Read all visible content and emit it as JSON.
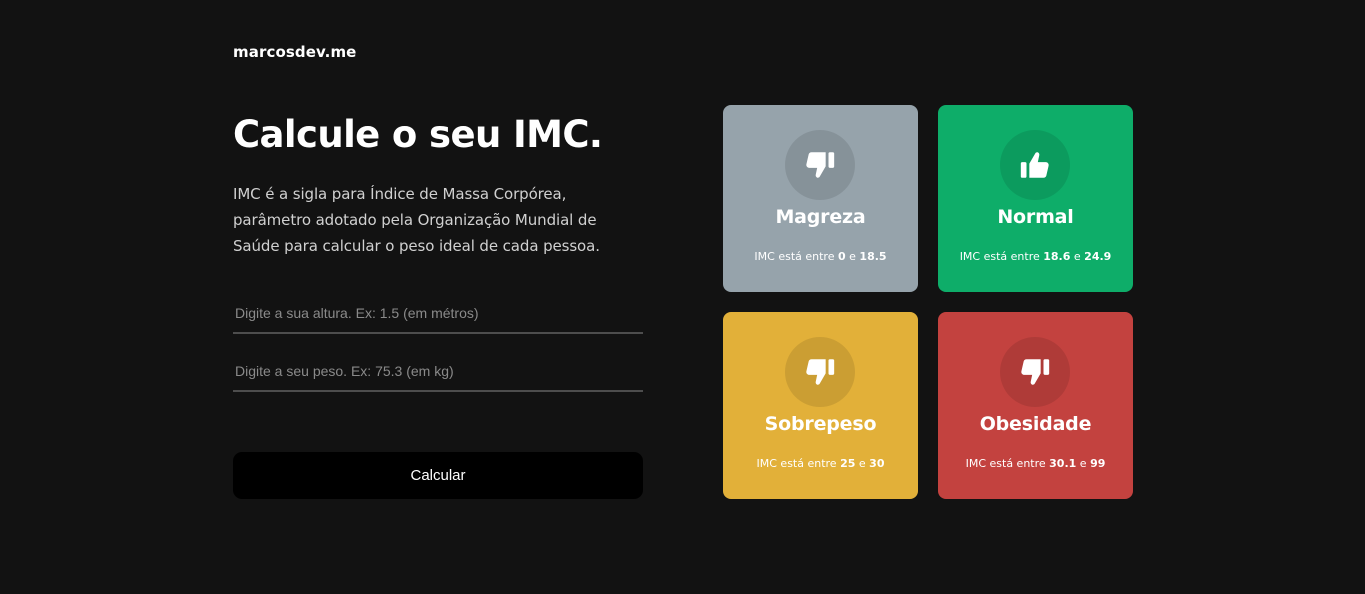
{
  "brand": "marcosdev.me",
  "hero": {
    "title": "Calcule o seu IMC.",
    "description_lines": [
      "IMC é a sigla para Índice de Massa Corpórea,",
      "parâmetro adotado pela Organização Mundial de",
      "Saúde para calcular o peso ideal de cada pessoa."
    ]
  },
  "form": {
    "height_placeholder": "Digite a sua altura. Ex: 1.5 (em métros)",
    "weight_placeholder": "Digite a seu peso. Ex: 75.3 (em kg)",
    "submit_label": "Calcular"
  },
  "categories": [
    {
      "title": "Magreza",
      "range_prefix": "IMC está entre",
      "min": "0",
      "joiner": "e",
      "max": "18.5",
      "color": "#96a3ab",
      "icon": "thumbs-down-icon"
    },
    {
      "title": "Normal",
      "range_prefix": "IMC está entre",
      "min": "18.6",
      "joiner": "e",
      "max": "24.9",
      "color": "#0ead69",
      "icon": "thumbs-up-icon"
    },
    {
      "title": "Sobrepeso",
      "range_prefix": "IMC está entre",
      "min": "25",
      "joiner": "e",
      "max": "30",
      "color": "#e2b039",
      "icon": "thumbs-down-icon"
    },
    {
      "title": "Obesidade",
      "range_prefix": "IMC está entre",
      "min": "30.1",
      "joiner": "e",
      "max": "99",
      "color": "#c3423f",
      "icon": "thumbs-down-icon"
    }
  ]
}
